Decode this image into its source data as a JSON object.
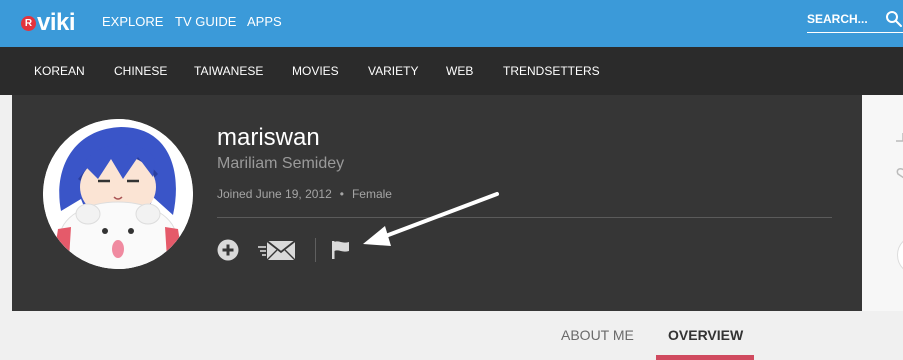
{
  "brand": {
    "badge": "R",
    "name": "viki"
  },
  "topnav": [
    "EXPLORE",
    "TV GUIDE",
    "APPS"
  ],
  "search": {
    "label": "SEARCH..."
  },
  "categories": [
    "KOREAN",
    "CHINESE",
    "TAIWANESE",
    "MOVIES",
    "VARIETY",
    "WEB",
    "TRENDSETTERS"
  ],
  "profile": {
    "username": "mariswan",
    "real_name": "Mariliam Semidey",
    "joined": "Joined June 19, 2012",
    "separator": "•",
    "gender": "Female"
  },
  "actions": [
    "plus-circle-icon",
    "envelope-icon",
    "flag-icon"
  ],
  "tabs": {
    "about": "ABOUT ME",
    "overview": "OVERVIEW",
    "active": "OVERVIEW"
  },
  "colors": {
    "topbar": "#3b9ad9",
    "catbar": "#2b2b2b",
    "panel": "#363636",
    "accent": "#d04a5f",
    "logo_badge": "#e3343d"
  }
}
